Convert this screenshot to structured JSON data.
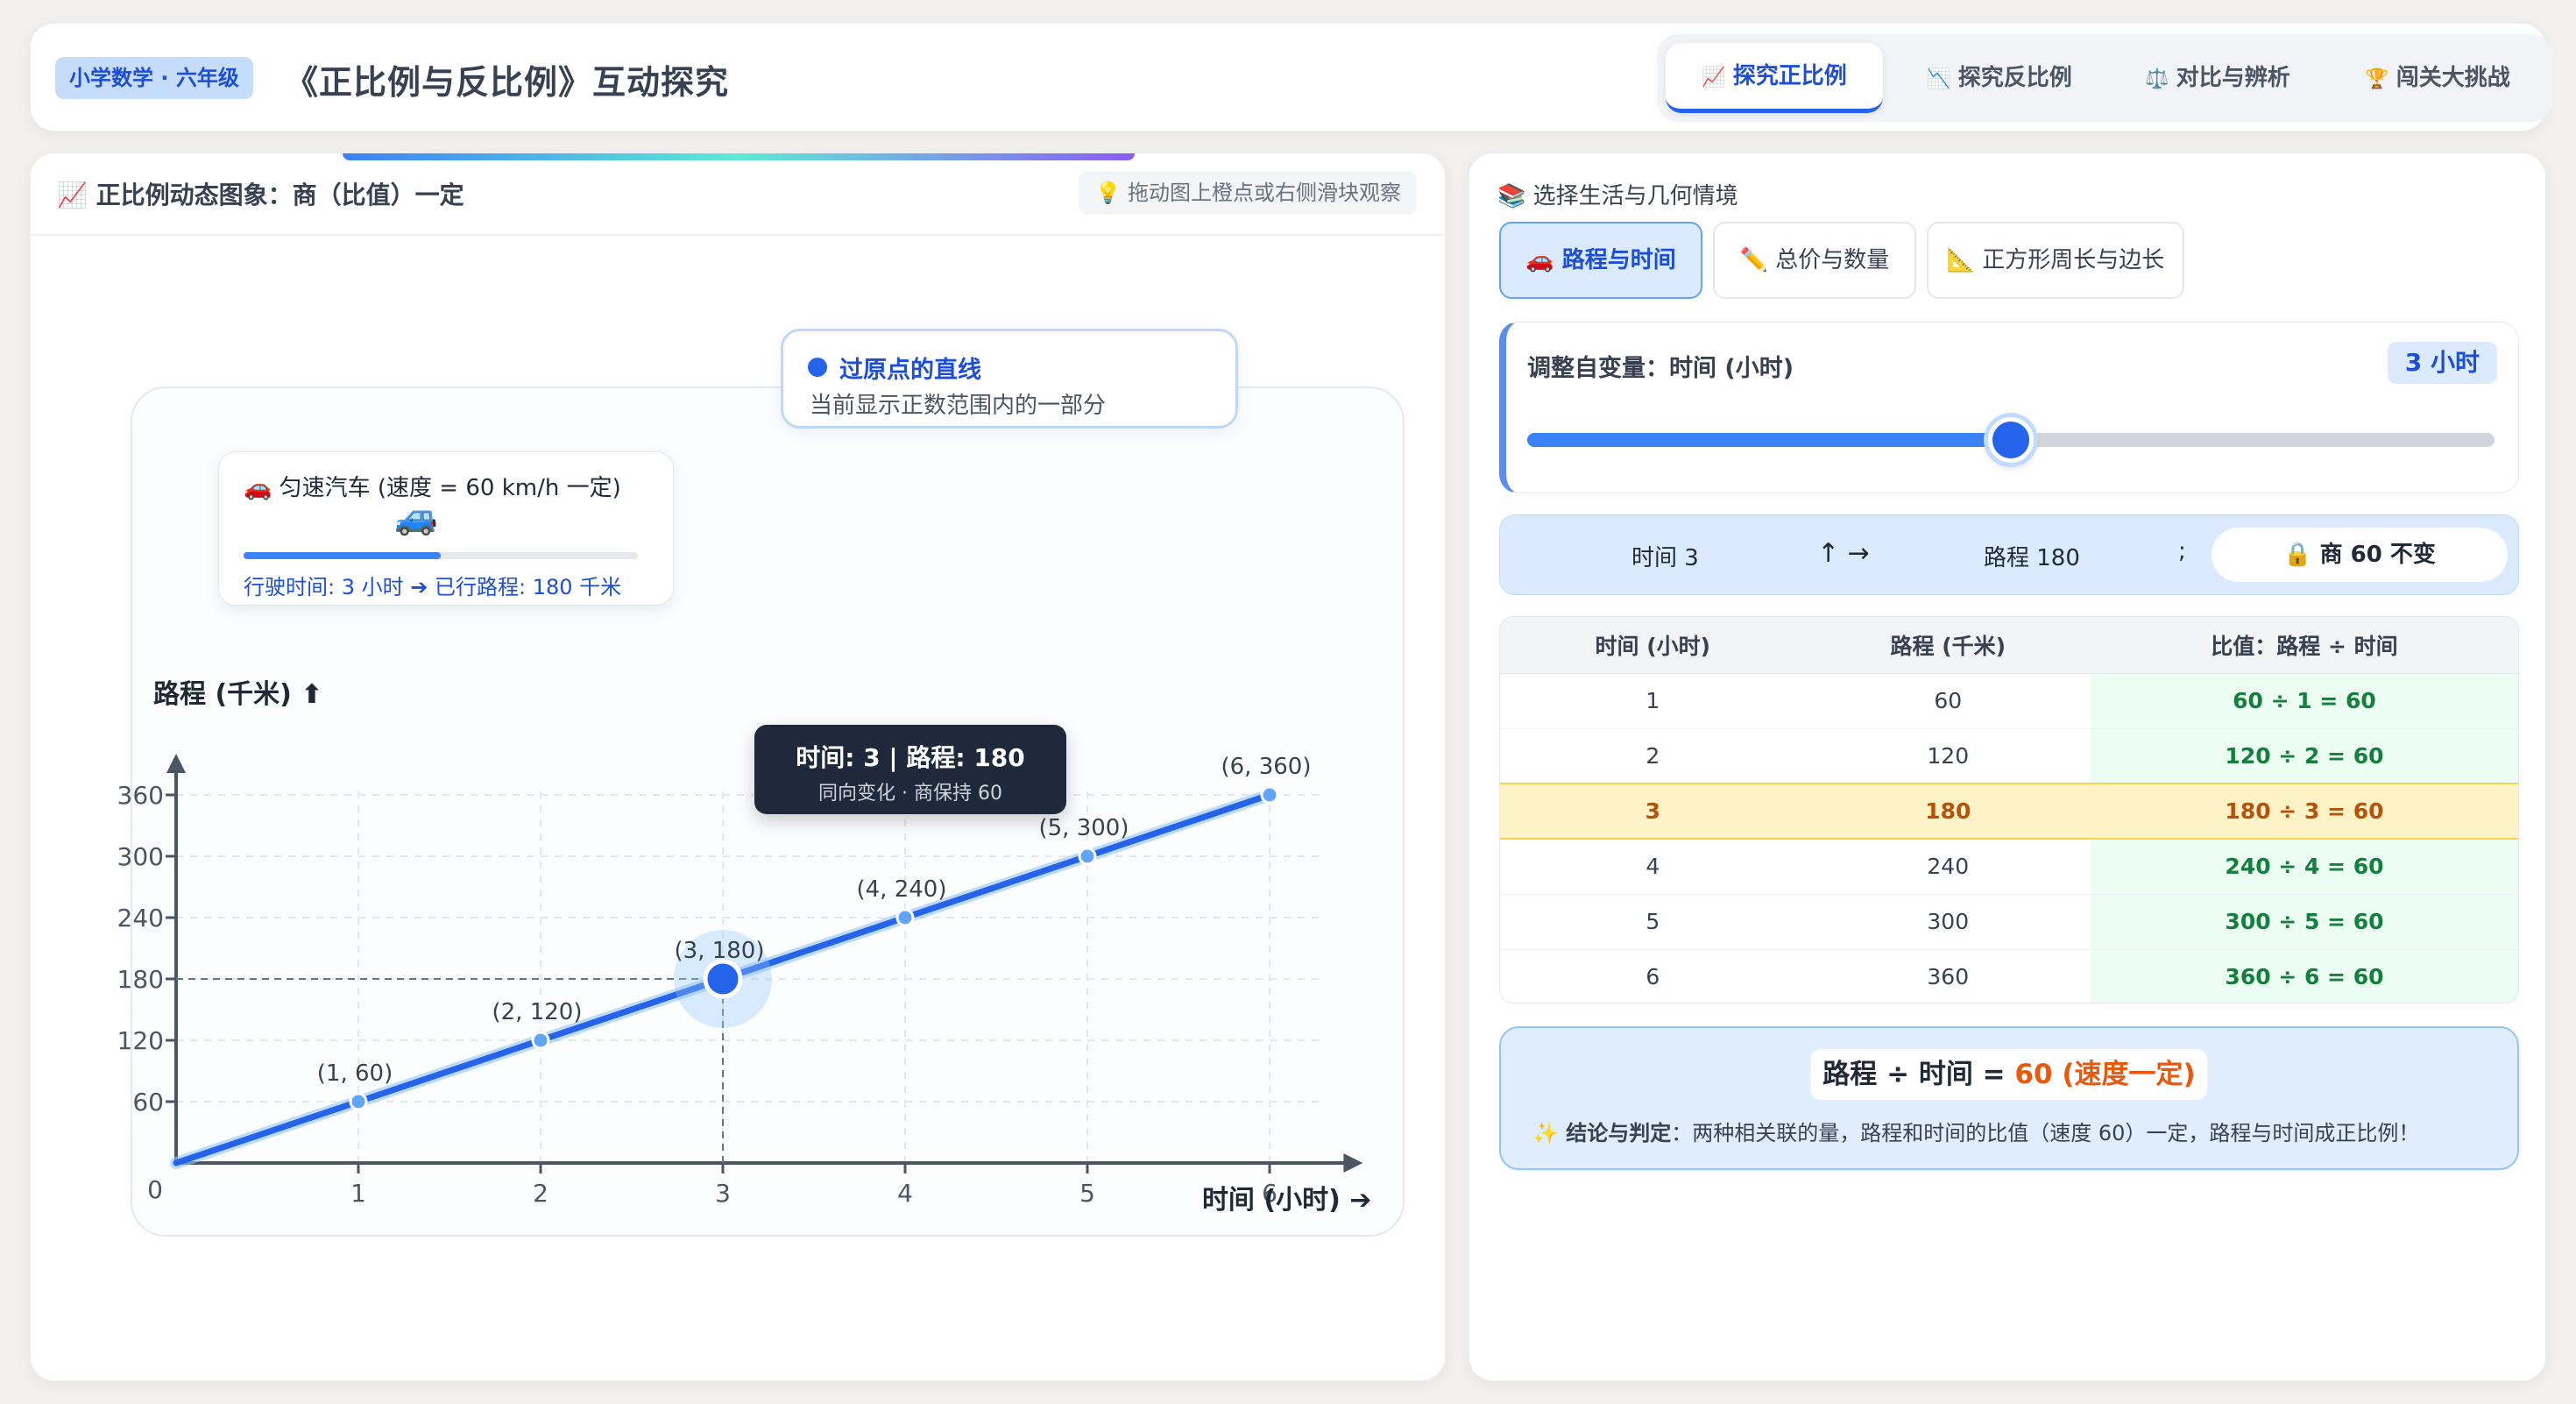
{
  "header": {
    "grade_badge": "小学数学 · 六年级",
    "title": "《正比例与反比例》互动探究",
    "tabs": [
      {
        "icon": "📈",
        "label": "探究正比例"
      },
      {
        "icon": "📉",
        "label": "探究反比例"
      },
      {
        "icon": "⚖️",
        "label": "对比与辨析"
      },
      {
        "icon": "🏆",
        "label": "闯关大挑战"
      }
    ]
  },
  "left": {
    "title": "📈 正比例动态图象：商（比值）一定",
    "hint": "💡 拖动图上橙点或右侧滑块观察",
    "car": {
      "title": "🚗 匀速汽车 (速度 = 60 km/h 一定)",
      "emoji": "🚙",
      "progress": 0.5,
      "status": "行驶时间: 3 小时 ➔ 已行路程: 180 千米"
    },
    "line_note": {
      "title": "过原点的直线",
      "subtitle": "当前显示正数范围内的一部分"
    },
    "tooltip": {
      "title": "时间: 3 | 路程: 180",
      "subtitle": "同向变化 · 商保持 60"
    }
  },
  "chart_data": {
    "type": "line",
    "xlabel": "时间 (小时) ➔",
    "ylabel": "路程 (千米) ⬆",
    "origin_label": "0",
    "xlim": [
      0,
      6.3
    ],
    "ylim": [
      0,
      366
    ],
    "xticks": [
      1,
      2,
      3,
      4,
      5,
      6
    ],
    "yticks": [
      60,
      120,
      180,
      240,
      300,
      360
    ],
    "grid": true,
    "points": [
      {
        "x": 1,
        "y": 60,
        "label": "(1, 60)"
      },
      {
        "x": 2,
        "y": 120,
        "label": "(2, 120)"
      },
      {
        "x": 3,
        "y": 180,
        "label": "(3, 180)"
      },
      {
        "x": 4,
        "y": 240,
        "label": "(4, 240)"
      },
      {
        "x": 5,
        "y": 300,
        "label": "(5, 300)"
      },
      {
        "x": 6,
        "y": 360,
        "label": "(6, 360)"
      }
    ],
    "selected_x": 3,
    "line_color": "#2563eb"
  },
  "right": {
    "title": "📚 选择生活与几何情境",
    "contexts": [
      {
        "label": "🚗 路程与时间"
      },
      {
        "label": "✏️ 总价与数量"
      },
      {
        "label": "📐 正方形周长与边长"
      }
    ],
    "slider": {
      "label": "调整自变量：时间 (小时)",
      "value_text": "3 小时",
      "min": 0,
      "max": 6,
      "value": 3
    },
    "relation": {
      "x_text": "时间 3",
      "arrow": "↑ →",
      "y_text": "路程 180",
      "sep": ";",
      "lock_text": "🔒 商 60 不变"
    },
    "table": {
      "headers": [
        "时间 (小时)",
        "路程 (千米)",
        "比值：路程 ÷ 时间"
      ],
      "rows": [
        [
          "1",
          "60",
          "60 ÷ 1 = 60"
        ],
        [
          "2",
          "120",
          "120 ÷ 2 = 60"
        ],
        [
          "3",
          "180",
          "180 ÷ 3 = 60"
        ],
        [
          "4",
          "240",
          "240 ÷ 4 = 60"
        ],
        [
          "5",
          "300",
          "300 ÷ 5 = 60"
        ],
        [
          "6",
          "360",
          "360 ÷ 6 = 60"
        ]
      ],
      "highlight_row": 2
    },
    "conclusion": {
      "formula_prefix": "路程 ÷ 时间 = ",
      "formula_value": "60 (速度一定)",
      "label": "✨ 结论与判定",
      "text": "：两种相关联的量，路程和时间的比值（速度 60）一定，路程与时间成正比例！"
    }
  }
}
